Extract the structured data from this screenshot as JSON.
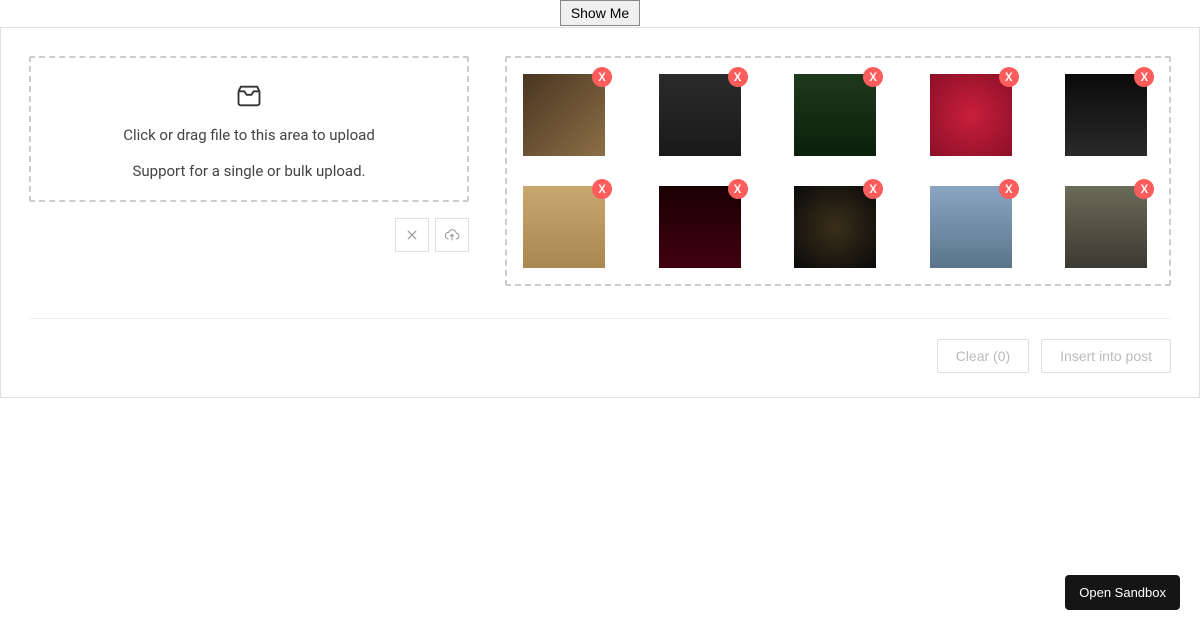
{
  "header": {
    "show_me": "Show Me"
  },
  "dropzone": {
    "title": "Click or drag file to this area to upload",
    "subtitle": "Support for a single or bulk upload."
  },
  "gallery": {
    "remove_label": "X",
    "thumbs": [
      {
        "name": "eiffel-tower"
      },
      {
        "name": "food-truck"
      },
      {
        "name": "waterfall"
      },
      {
        "name": "strawberries"
      },
      {
        "name": "diver-dark"
      },
      {
        "name": "clothespins"
      },
      {
        "name": "red-velvet"
      },
      {
        "name": "bokeh-lights"
      },
      {
        "name": "city-skyline"
      },
      {
        "name": "wolf"
      }
    ]
  },
  "footer": {
    "clear_label": "Clear (0)",
    "insert_label": "Insert into post"
  },
  "sandbox": {
    "open_label": "Open Sandbox"
  }
}
